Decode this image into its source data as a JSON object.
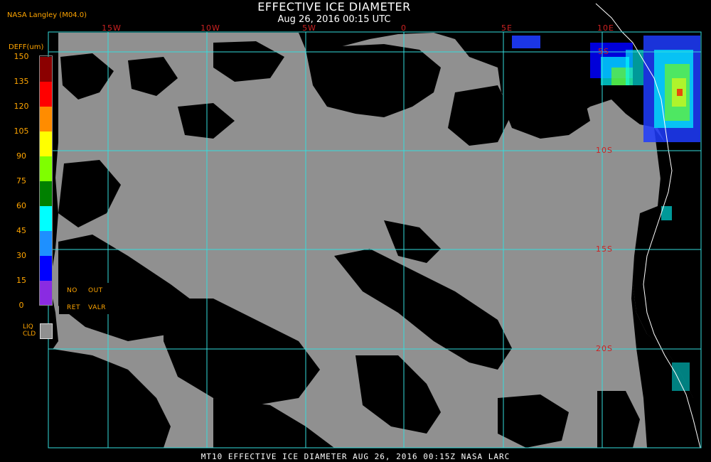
{
  "header": {
    "title": "EFFECTIVE ICE DIAMETER",
    "subtitle": "Aug 26, 2016 00:15 UTC",
    "producer": "NASA Langley (M04.0)"
  },
  "map": {
    "lon_labels": [
      "15W",
      "10W",
      "5W",
      "0",
      "5E",
      "10E"
    ],
    "lat_labels": [
      "5S",
      "10S",
      "15S",
      "20S"
    ],
    "colors": {
      "background": "#000000",
      "liquid_cloud": "#909090",
      "grid": "#33dddd",
      "coast": "#ffffff",
      "grid_label": "#cc2222"
    }
  },
  "legend": {
    "title": "DEFF(um)",
    "ticks": [
      "150",
      "135",
      "120",
      "105",
      "90",
      "75",
      "60",
      "45",
      "30",
      "15",
      "0"
    ],
    "colors": [
      "#8b0000",
      "#ff0000",
      "#ff8c00",
      "#ffff00",
      "#7fff00",
      "#008000",
      "#00ffff",
      "#1e90ff",
      "#0000ff",
      "#8a2be2"
    ],
    "no_ret": [
      "NO",
      "RET"
    ],
    "out_valr": [
      "OUT",
      "VALR"
    ],
    "liq_cld": [
      "LIQ",
      "CLD"
    ],
    "liq_cld_color": "#909090"
  },
  "footer": {
    "text": "MT10  EFFECTIVE ICE DIAMETER  AUG 26, 2016 00:15Z  NASA LARC"
  }
}
